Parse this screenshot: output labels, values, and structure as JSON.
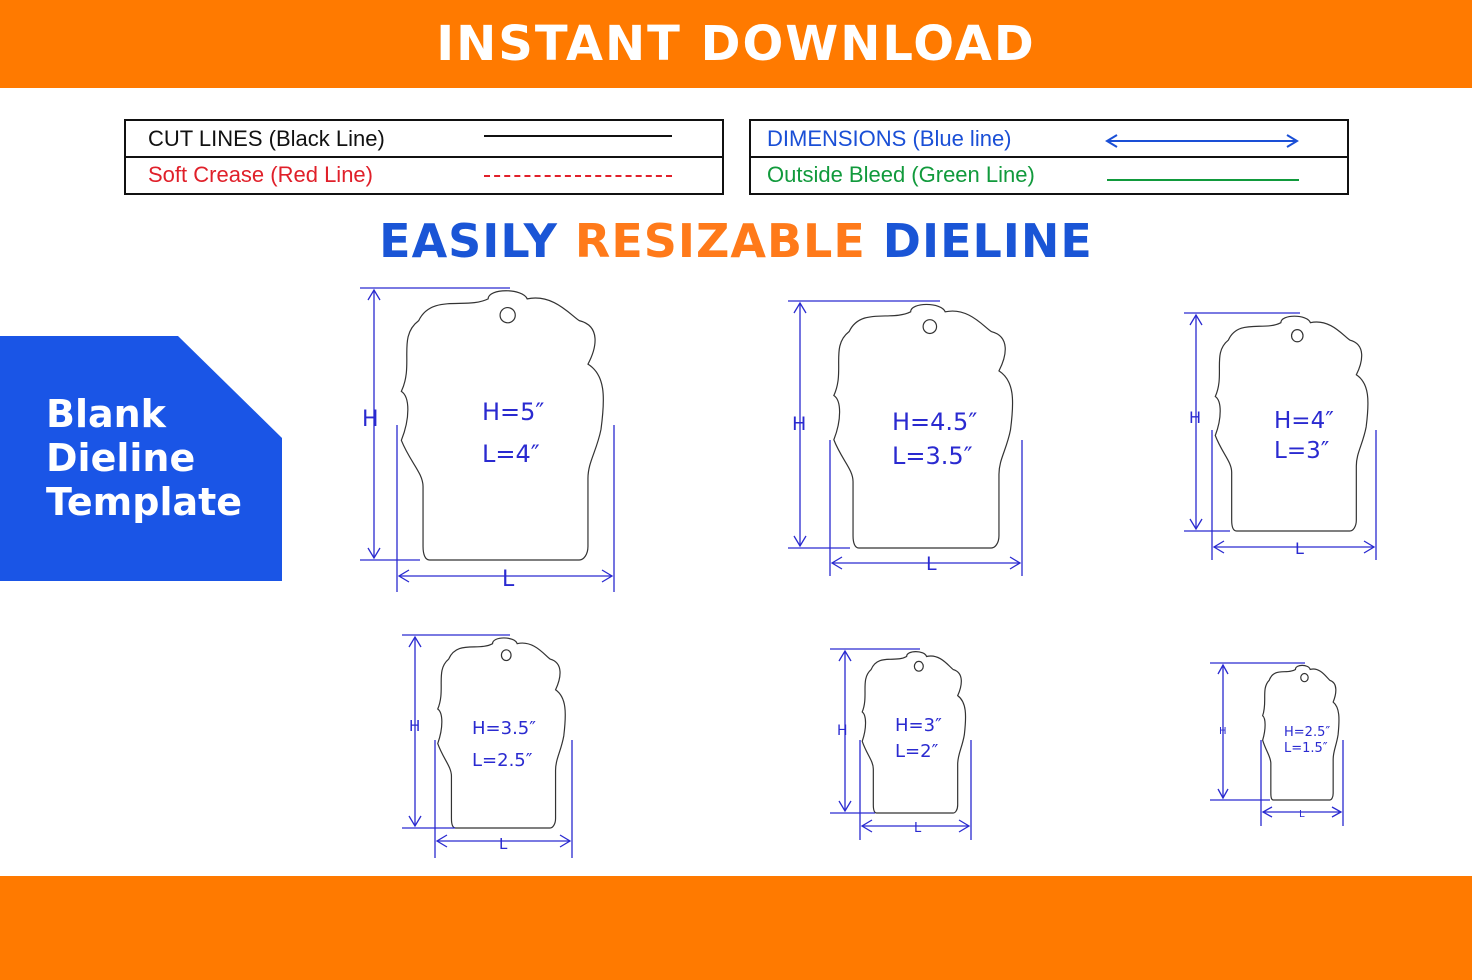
{
  "banner": {
    "title": "INSTANT DOWNLOAD"
  },
  "legend": {
    "left": [
      {
        "label": "CUT LINES (Black Line)",
        "color": "#111111",
        "style": "solid"
      },
      {
        "label": "Soft Crease (Red Line)",
        "color": "#e0202a",
        "style": "dashed"
      }
    ],
    "right": [
      {
        "label": "DIMENSIONS (Blue line)",
        "color": "#1a4fd6",
        "style": "arrow"
      },
      {
        "label": "Outside Bleed (Green Line)",
        "color": "#119a3c",
        "style": "solid"
      }
    ]
  },
  "headline": {
    "part1": "EASILY ",
    "part2": "RESIZABLE ",
    "part3": "DIELINE"
  },
  "side_panel": {
    "line1": "Blank",
    "line2": "Dieline",
    "line3": "Template"
  },
  "tags": [
    {
      "h_text": "H=5″",
      "l_text": "L=4″",
      "h_label": "H",
      "l_label": "L"
    },
    {
      "h_text": "H=4.5″",
      "l_text": "L=3.5″",
      "h_label": "H",
      "l_label": "L"
    },
    {
      "h_text": "H=4″",
      "l_text": "L=3″",
      "h_label": "H",
      "l_label": "L"
    },
    {
      "h_text": "H=3.5″",
      "l_text": "L=2.5″",
      "h_label": "H",
      "l_label": "L"
    },
    {
      "h_text": "H=3″",
      "l_text": "L=2″",
      "h_label": "H",
      "l_label": "L"
    },
    {
      "h_text": "H=2.5″",
      "l_text": "L=1.5″",
      "h_label": "H",
      "l_label": "L"
    }
  ],
  "colors": {
    "orange": "#ff7a00",
    "blue": "#1a55e6",
    "dimension_blue": "#2a2ad0",
    "headline_blue": "#1a55d6",
    "headline_orange": "#ff7a1a"
  }
}
